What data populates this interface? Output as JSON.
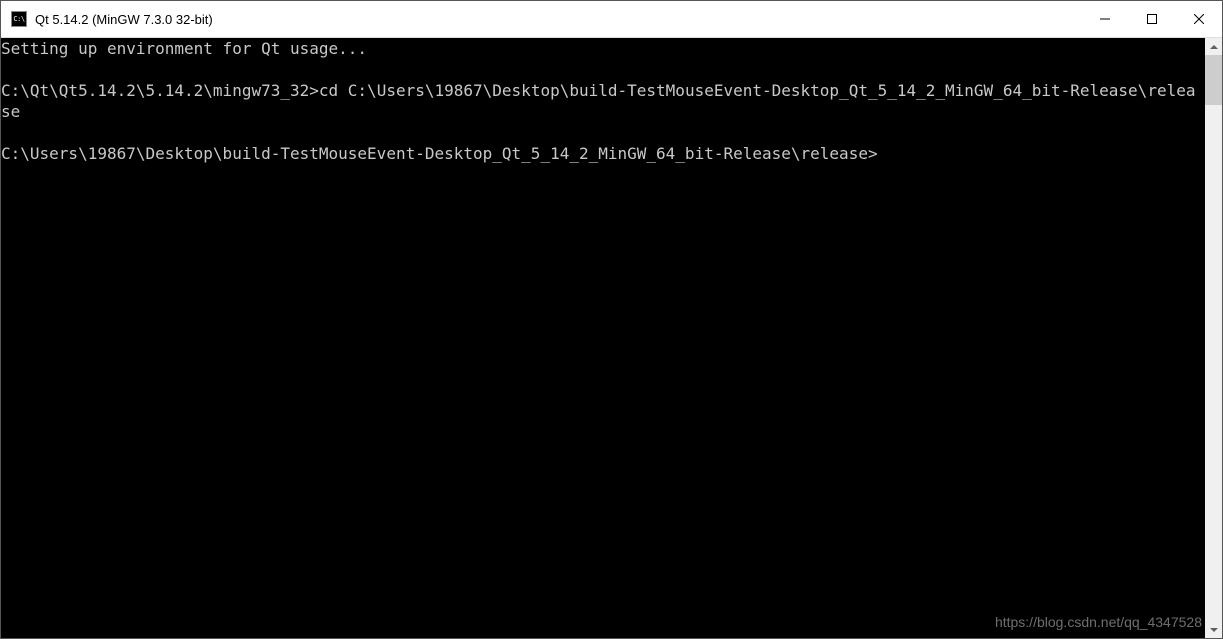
{
  "window": {
    "icon_text": "C:\\",
    "title": "Qt 5.14.2 (MinGW 7.3.0 32-bit)"
  },
  "terminal": {
    "line1": "Setting up environment for Qt usage...",
    "line2_prompt": "C:\\Qt\\Qt5.14.2\\5.14.2\\mingw73_32>",
    "line2_cmd": "cd C:\\Users\\19867\\Desktop\\build-TestMouseEvent-Desktop_Qt_5_14_2_MinGW_64_bit-Release\\release",
    "line3_prompt": "C:\\Users\\19867\\Desktop\\build-TestMouseEvent-Desktop_Qt_5_14_2_MinGW_64_bit-Release\\release>"
  },
  "watermark": "https://blog.csdn.net/qq_4347528"
}
